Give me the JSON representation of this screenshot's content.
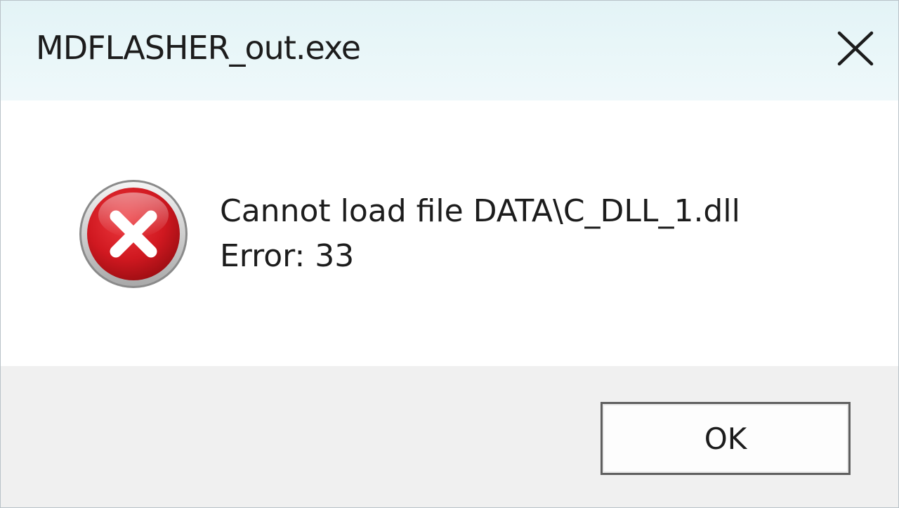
{
  "window": {
    "title": "MDFLASHER_out.exe",
    "close_icon": "close-icon"
  },
  "message": {
    "icon": "error-icon",
    "line1": "Cannot load file DATA\\C_DLL_1.dll",
    "line2": "Error: 33"
  },
  "buttons": {
    "ok_label": "OK"
  },
  "colors": {
    "titlebar": "#e3f3f6",
    "error_red": "#c8141c",
    "footer": "#f0f0f0"
  }
}
